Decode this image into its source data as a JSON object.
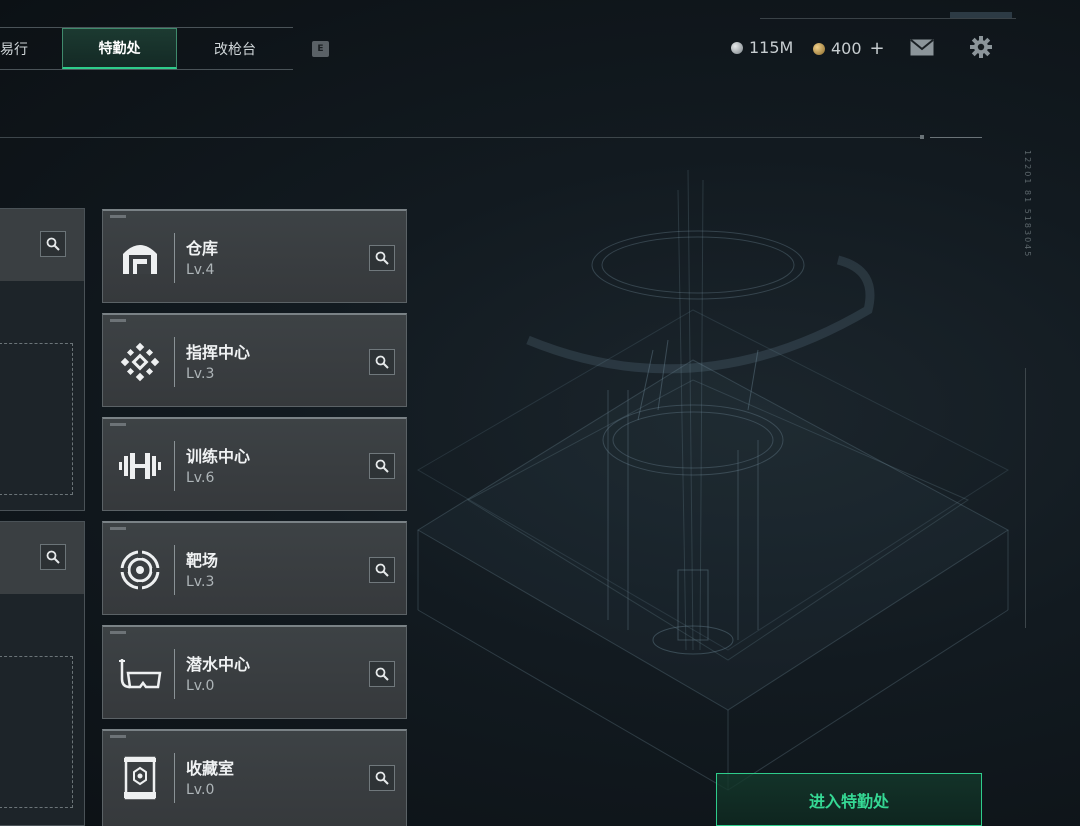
{
  "tabs": [
    {
      "label": "易行"
    },
    {
      "label": "特勤处"
    },
    {
      "label": "改枪台"
    }
  ],
  "tab_hotkey": "E",
  "currency": {
    "silver": "115M",
    "gold": "400",
    "add": "+"
  },
  "icons": {
    "mail": "mail-icon",
    "settings": "gear-icon",
    "search": "magnifier-icon"
  },
  "facilities": [
    {
      "name": "仓库",
      "level": "Lv.4",
      "icon": "warehouse-icon"
    },
    {
      "name": "指挥中心",
      "level": "Lv.3",
      "icon": "command-center-icon"
    },
    {
      "name": "训练中心",
      "level": "Lv.6",
      "icon": "dumbbell-icon"
    },
    {
      "name": "靶场",
      "level": "Lv.3",
      "icon": "target-icon"
    },
    {
      "name": "潜水中心",
      "level": "Lv.0",
      "icon": "diving-mask-icon"
    },
    {
      "name": "收藏室",
      "level": "Lv.0",
      "icon": "collection-case-icon"
    }
  ],
  "enter_button": "进入特勤处",
  "side_code": "12201 81 5183045",
  "colors": {
    "accent": "#2ecc8b",
    "card_bg": "#3a3e41",
    "bg": "#121a20"
  }
}
